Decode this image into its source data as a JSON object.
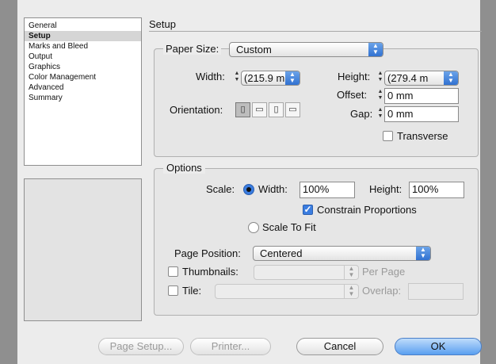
{
  "sidebar": {
    "items": [
      "General",
      "Setup",
      "Marks and Bleed",
      "Output",
      "Graphics",
      "Color Management",
      "Advanced",
      "Summary"
    ],
    "selected": "Setup"
  },
  "setup": {
    "title": "Setup"
  },
  "paper": {
    "size_label": "Paper Size:",
    "size_value": "Custom",
    "width_label": "Width:",
    "width_value": "(215.9 m",
    "height_label": "Height:",
    "height_value": "(279.4 m",
    "orientation_label": "Orientation:",
    "offset_label": "Offset:",
    "offset_value": "0 mm",
    "gap_label": "Gap:",
    "gap_value": "0 mm",
    "transverse_label": "Transverse"
  },
  "options": {
    "legend": "Options",
    "scale_label": "Scale:",
    "width_radio_label": "Width:",
    "width_value": "100%",
    "height_label": "Height:",
    "height_value": "100%",
    "constrain_label": "Constrain Proportions",
    "scale_to_fit_label": "Scale To Fit",
    "page_position_label": "Page Position:",
    "page_position_value": "Centered",
    "thumbnails_label": "Thumbnails:",
    "per_page_label": "Per Page",
    "tile_label": "Tile:",
    "overlap_label": "Overlap:"
  },
  "buttons": {
    "page_setup": "Page Setup...",
    "printer": "Printer...",
    "cancel": "Cancel",
    "ok": "OK"
  },
  "colors": {
    "accent": "#3b7de0"
  }
}
